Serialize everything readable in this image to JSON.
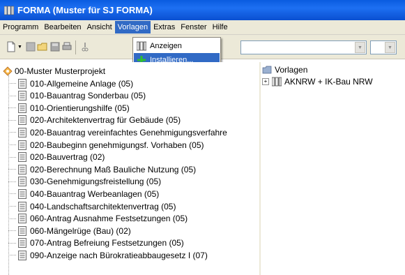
{
  "window": {
    "title": "FORMA (Muster für SJ FORMA)"
  },
  "menu": [
    {
      "label": "Programm"
    },
    {
      "label": "Bearbeiten"
    },
    {
      "label": "Ansicht"
    },
    {
      "label": "Vorlagen",
      "active": true
    },
    {
      "label": "Extras"
    },
    {
      "label": "Fenster"
    },
    {
      "label": "Hilfe"
    }
  ],
  "dropdown": {
    "items": [
      {
        "label": "Anzeigen",
        "icon": "book-icon"
      },
      {
        "label": "Installieren...",
        "icon": "plus-icon",
        "selected": true
      }
    ]
  },
  "left_tree": {
    "root": "00-Muster Musterprojekt",
    "items": [
      "010-Allgemeine Anlage (05)",
      "010-Bauantrag Sonderbau (05)",
      "010-Orientierungshilfe (05)",
      "020-Architektenvertrag für Gebäude (05)",
      "020-Bauantrag vereinfachtes Genehmigungsverfahre",
      "020-Baubeginn genehmigungsf. Vorhaben (05)",
      "020-Bauvertrag (02)",
      "020-Berechnung Maß Bauliche Nutzung (05)",
      "030-Genehmigungsfreistellung (05)",
      "040-Bauantrag Werbeanlagen (05)",
      "040-Landschaftsarchitektenvertrag (05)",
      "060-Antrag Ausnahme Festsetzungen (05)",
      "060-Mängelrüge (Bau) (02)",
      "070-Antrag Befreiung Festsetzungen (05)",
      "090-Anzeige nach Bürokratieabbaugesetz I (07)"
    ]
  },
  "right_tree": {
    "root": "Vorlagen",
    "child": "AKNRW + IK-Bau NRW",
    "expander": "+"
  },
  "colors": {
    "titlebar": "#0a5ce0",
    "menu_highlight": "#316ac5",
    "chrome": "#ece9d8"
  }
}
